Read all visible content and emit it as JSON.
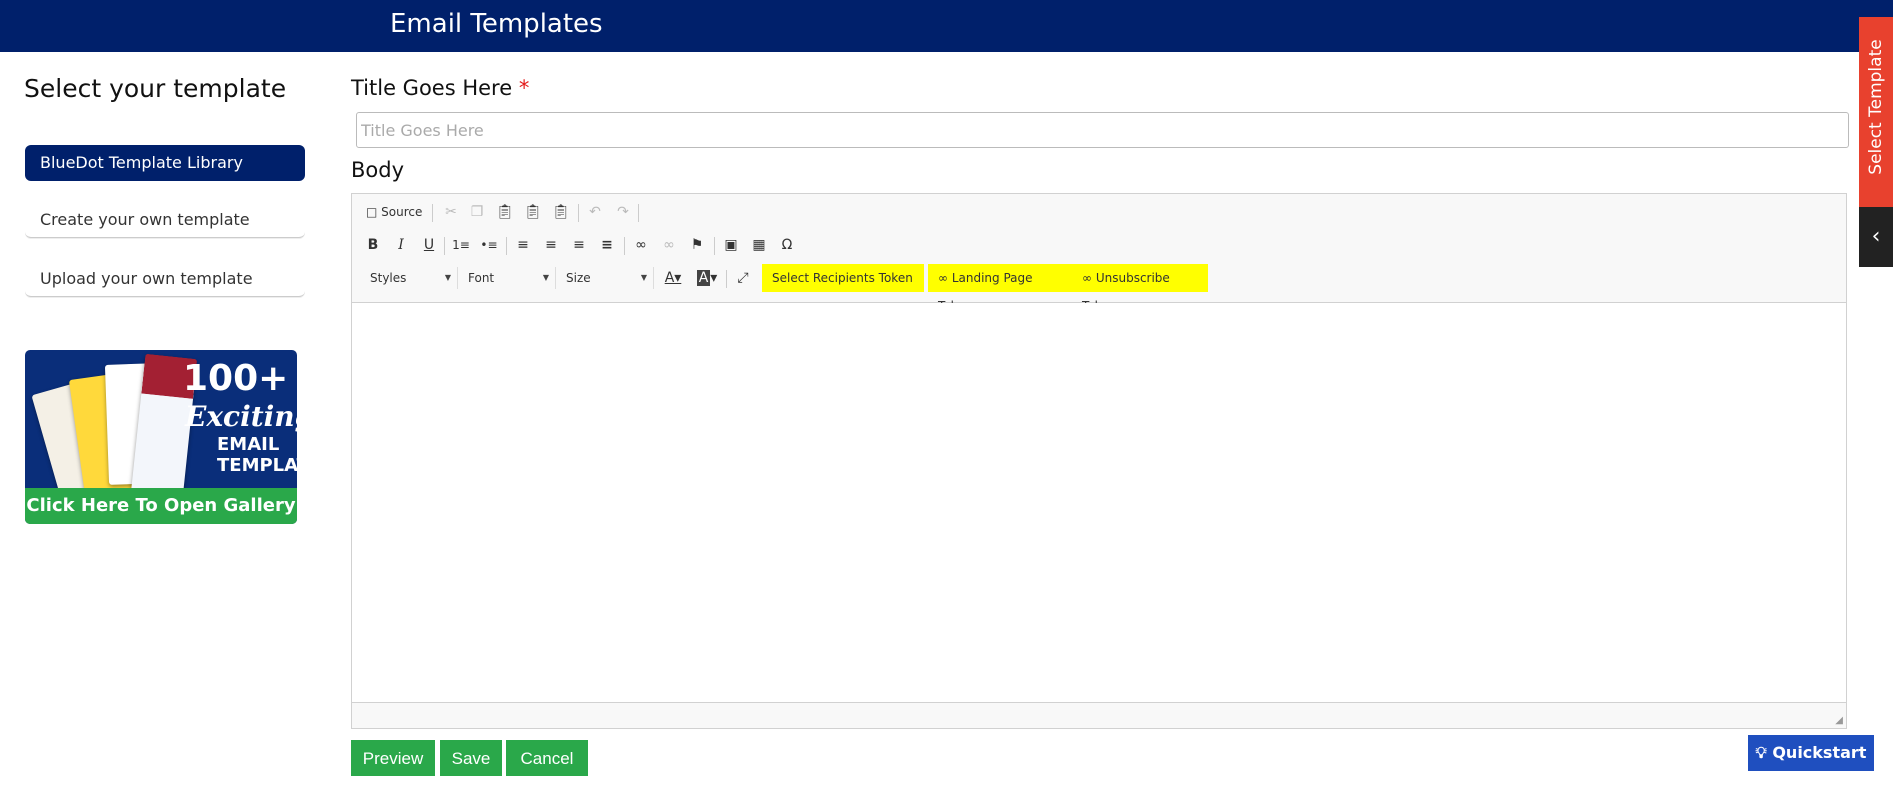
{
  "header": {
    "title": "Email Templates"
  },
  "sidebar": {
    "heading": "Select your template",
    "items": [
      {
        "label": "BlueDot Template Library"
      },
      {
        "label": "Create your own template"
      },
      {
        "label": "Upload your own template"
      }
    ],
    "banner": {
      "big_text": "100+",
      "script_text": "Exciting",
      "line1": "EMAIL",
      "line2": "TEMPLATES",
      "cta": "Click Here To Open Gallery"
    }
  },
  "form": {
    "title_label": "Title Goes Here",
    "required_mark": "*",
    "title_placeholder": "Title Goes Here",
    "body_label": "Body"
  },
  "editor": {
    "source_label": "Source",
    "styles_label": "Styles",
    "font_label": "Font",
    "size_label": "Size",
    "recipients_token": "Select Recipients Token",
    "landing_token": "Landing Page Token",
    "unsubscribe_token": "Unsubscribe Token"
  },
  "buttons": {
    "preview": "Preview",
    "save": "Save",
    "cancel": "Cancel"
  },
  "side_tab": {
    "label": "Select Template"
  },
  "quickstart": {
    "label": "Quickstart"
  },
  "colors": {
    "header": "#00206b",
    "green": "#2aa84a",
    "token_highlight": "#ffff00",
    "side_tab": "#e8412e"
  }
}
